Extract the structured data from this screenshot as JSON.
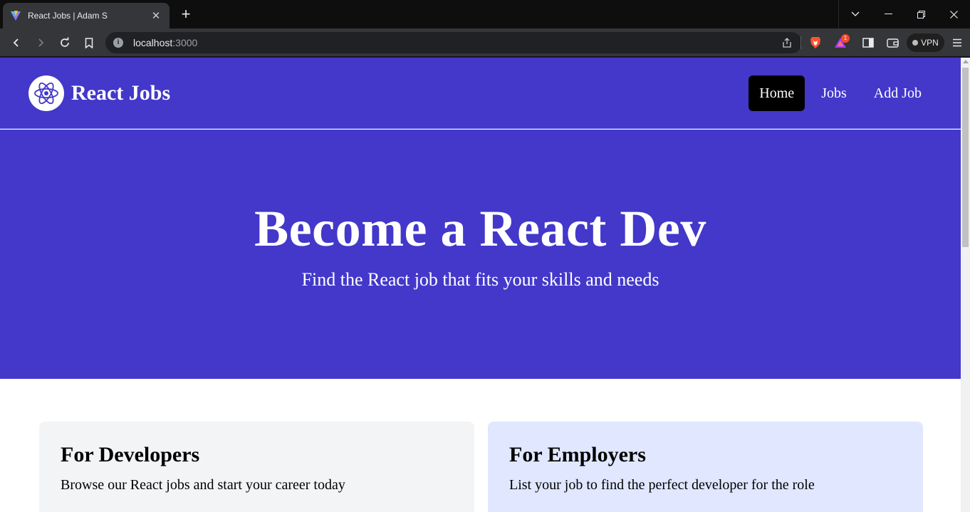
{
  "browser": {
    "tab_title": "React Jobs | Adam S",
    "url_host": "localhost",
    "url_port": ":3000",
    "vpn_label": "VPN",
    "notification_count": "1"
  },
  "nav": {
    "brand": "React Jobs",
    "links": [
      {
        "label": "Home",
        "active": true
      },
      {
        "label": "Jobs",
        "active": false
      },
      {
        "label": "Add Job",
        "active": false
      }
    ]
  },
  "hero": {
    "title": "Become a React Dev",
    "subtitle": "Find the React job that fits your skills and needs"
  },
  "cards": [
    {
      "title": "For Developers",
      "text": "Browse our React jobs and start your career today"
    },
    {
      "title": "For Employers",
      "text": "List your job to find the perfect developer for the role"
    }
  ],
  "colors": {
    "brand_indigo": "#4338ca",
    "nav_border": "#6366f1",
    "active_link": "#000000",
    "card_dev_bg": "#f3f4f6",
    "card_emp_bg": "#e0e7ff"
  }
}
